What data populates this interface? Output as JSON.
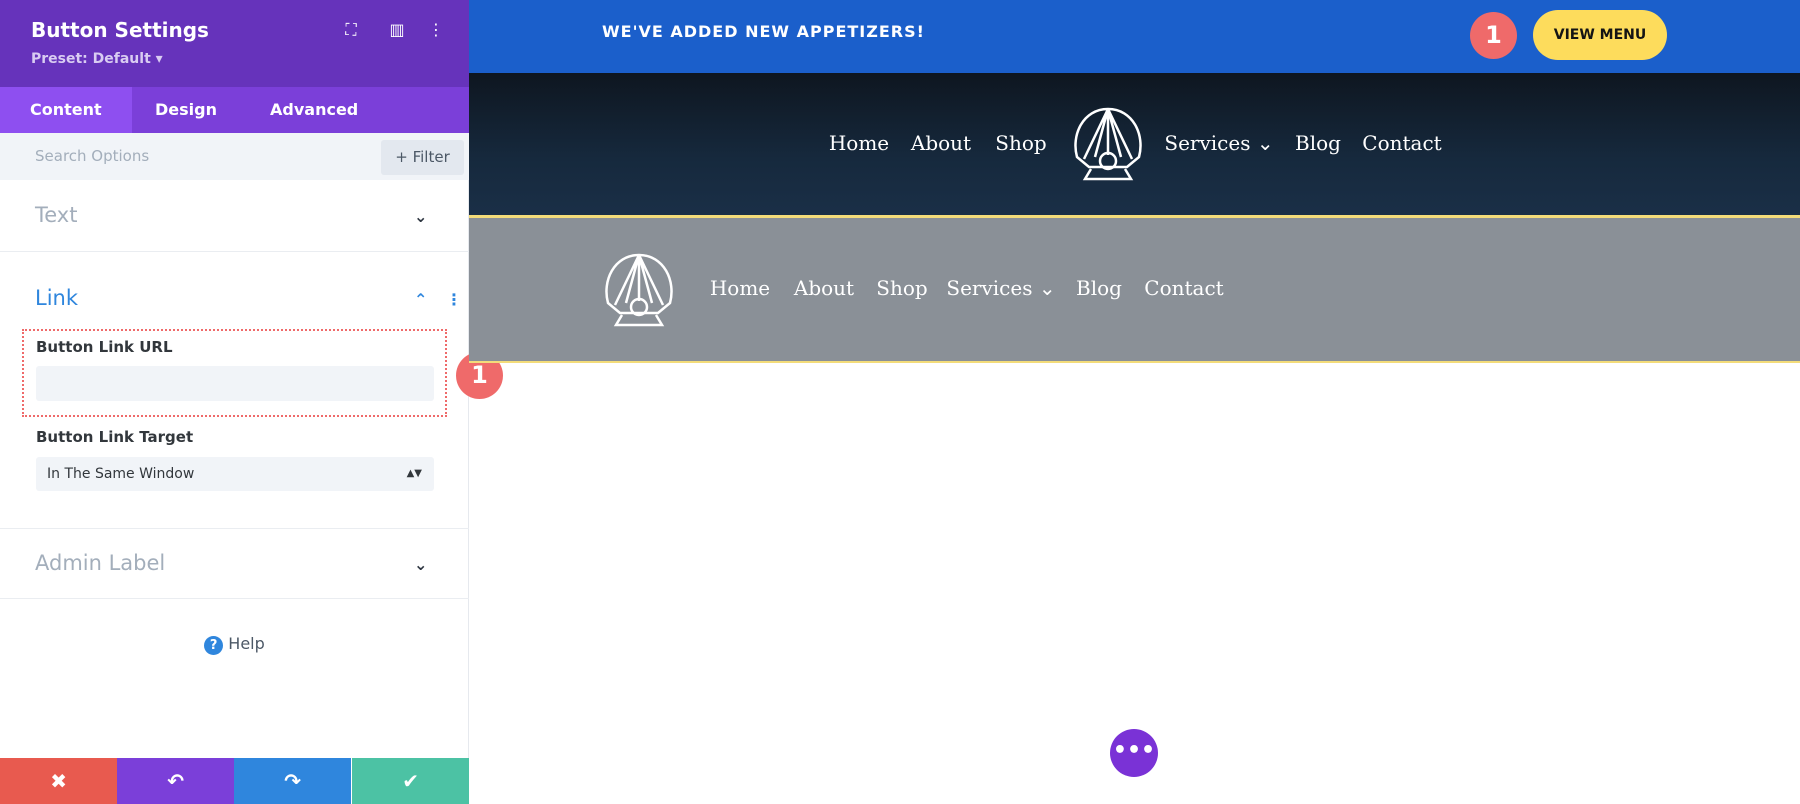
{
  "panel": {
    "title": "Button Settings",
    "preset": "Preset: Default ▾",
    "tabs": [
      "Content",
      "Design",
      "Advanced"
    ],
    "search_placeholder": "Search Options",
    "filter": "+ Filter",
    "sections": {
      "text": "Text",
      "link": "Link",
      "admin": "Admin Label"
    },
    "link_url_label": "Button Link URL",
    "link_url_value": "",
    "link_target_label": "Button Link Target",
    "link_target_value": "In The Same Window",
    "help": "Help",
    "footer": {
      "cancel": "✖",
      "undo": "↶",
      "redo": "↷",
      "save": "✔",
      "colors": [
        "#e85a4f",
        "#7b3fd9",
        "#2f86dd",
        "#4cc2a4"
      ]
    }
  },
  "badge": "1",
  "site": {
    "promo": "WE'VE ADDED NEW APPETIZERS!",
    "view_menu": "VIEW MENU",
    "nav1": [
      "Home",
      "About",
      "Shop",
      "Services ⌄",
      "Blog",
      "Contact"
    ],
    "nav2": [
      "Home",
      "About",
      "Shop",
      "Services ⌄",
      "Blog",
      "Contact"
    ]
  },
  "colors": {
    "purple": "#6633bb",
    "blue": "#1b5fcb",
    "yellow": "#fddc5c",
    "badge": "#ef6a6a"
  }
}
